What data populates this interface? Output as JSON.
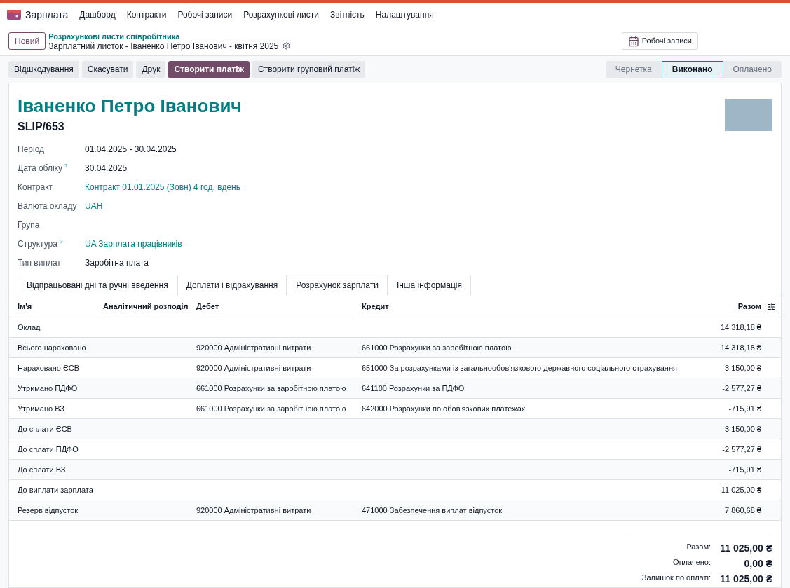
{
  "app": {
    "name": "Зарплата"
  },
  "menu": [
    "Дашборд",
    "Контракти",
    "Робочі записи",
    "Розрахункові листи",
    "Звітність",
    "Налаштування"
  ],
  "new_button": "Новий",
  "breadcrumb": {
    "parent": "Розрахункові листи співробітника",
    "current": "Зарплатний листок - Іваненко Петро Іванович - квітня 2025"
  },
  "smart_button": "Робочі записи",
  "actions": [
    {
      "label": "Відшкодування",
      "primary": false
    },
    {
      "label": "Скасувати",
      "primary": false
    },
    {
      "label": "Друк",
      "primary": false
    },
    {
      "label": "Створити платіж",
      "primary": true
    },
    {
      "label": "Створити груповий платіж",
      "primary": false
    }
  ],
  "stages": [
    {
      "label": "Чернетка",
      "selected": false
    },
    {
      "label": "Виконано",
      "selected": true
    },
    {
      "label": "Оплачено",
      "selected": false
    }
  ],
  "employee": "Іваненко Петро Іванович",
  "reference": "SLIP/653",
  "fields": [
    {
      "label": "Період",
      "value": "01.04.2025 - 30.04.2025",
      "kind": "text"
    },
    {
      "label": "Дата обліку",
      "help": "?",
      "value": "30.04.2025",
      "kind": "text"
    },
    {
      "label": "Контракт",
      "value": "Контракт 01.01.2025 (Зовн) 4 год. вдень",
      "kind": "link"
    },
    {
      "label": "Валюта окладу",
      "value": "UAH",
      "kind": "link"
    },
    {
      "label": "Група",
      "kind": "empty"
    },
    {
      "label": "Структура",
      "help": "?",
      "value": "UA Зарплата працівників",
      "kind": "link"
    },
    {
      "label": "Тип виплат",
      "value": "Заробітна плата",
      "kind": "text"
    }
  ],
  "tabs": [
    {
      "label": "Відпрацьовані дні та ручні введення",
      "selected": false
    },
    {
      "label": "Доплати і відрахування",
      "selected": false
    },
    {
      "label": "Розрахунок зарплати",
      "selected": true
    },
    {
      "label": "Інша інформація",
      "selected": false
    }
  ],
  "table": {
    "columns": [
      "Ім'я",
      "Аналітичний розподіл",
      "Дебет",
      "Кредит",
      "Разом"
    ],
    "rows": [
      {
        "name": "Оклад",
        "debit": "",
        "credit": "",
        "total": "14 318,18 ₴"
      },
      {
        "name": "Всього нараховано",
        "debit": "920000 Адміністративні витрати",
        "credit": "661000 Розрахунки за заробітною платою",
        "total": "14 318,18 ₴"
      },
      {
        "name": "Нараховано ЄСВ",
        "debit": "920000 Адміністративні витрати",
        "credit": "651000 За розрахунками із загальнообов'язкового державного соціального страхування",
        "total": "3 150,00 ₴"
      },
      {
        "name": "Утримано ПДФО",
        "debit": "661000 Розрахунки за заробітною платою",
        "credit": "641100 Розрахунки за ПДФО",
        "total": "-2 577,27 ₴"
      },
      {
        "name": "Утримано ВЗ",
        "debit": "661000 Розрахунки за заробітною платою",
        "credit": "642000 Розрахунки по обов'язкових платежах",
        "total": "-715,91 ₴"
      },
      {
        "name": "До сплати ЄСВ",
        "debit": "",
        "credit": "",
        "total": "3 150,00 ₴"
      },
      {
        "name": "До сплати ПДФО",
        "debit": "",
        "credit": "",
        "total": "-2 577,27 ₴"
      },
      {
        "name": "До сплати ВЗ",
        "debit": "",
        "credit": "",
        "total": "-715,91 ₴"
      },
      {
        "name": "До виплати зарплата",
        "debit": "",
        "credit": "",
        "total": "11 025,00 ₴"
      },
      {
        "name": "Резерв відпусток",
        "debit": "920000 Адміністративні витрати",
        "credit": "471000 Забезпечення виплат відпусток",
        "total": "7 860,68 ₴"
      }
    ]
  },
  "totals": [
    {
      "label": "Разом:",
      "value": "11 025,00 ₴"
    },
    {
      "label": "Оплачено:",
      "value": "0,00 ₴"
    },
    {
      "label": "Залишок по оплаті:",
      "value": "11 025,00 ₴"
    }
  ]
}
